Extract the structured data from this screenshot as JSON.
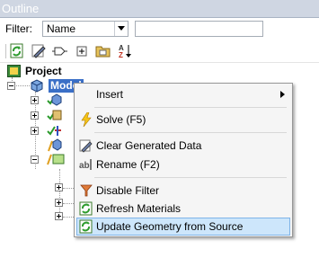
{
  "window": {
    "title": "Outline"
  },
  "filter": {
    "label": "Filter:",
    "selected": "Name",
    "search_value": ""
  },
  "toolbar": {
    "buttons": [
      "refresh-icon",
      "clear-data-icon",
      "tag-icon",
      "expand-all-icon",
      "folder-icon",
      "sort-az-icon"
    ],
    "sort_glyph": "AZ"
  },
  "tree": {
    "project_label": "Project",
    "model_label": "Model"
  },
  "context_menu": {
    "items": [
      {
        "label": "Insert",
        "submenu": true
      },
      {
        "label": "Solve (F5)"
      },
      {
        "label": "Clear Generated Data"
      },
      {
        "label": "Rename (F2)"
      },
      {
        "label": "Disable Filter"
      },
      {
        "label": "Refresh Materials"
      },
      {
        "label": "Update Geometry from Source",
        "highlighted": true
      }
    ]
  },
  "colors": {
    "selection": "#3a6fc7",
    "menu_highlight": "#cde6fb",
    "menu_highlight_border": "#7fb4e8",
    "titlebar": "#cfd6e2"
  }
}
